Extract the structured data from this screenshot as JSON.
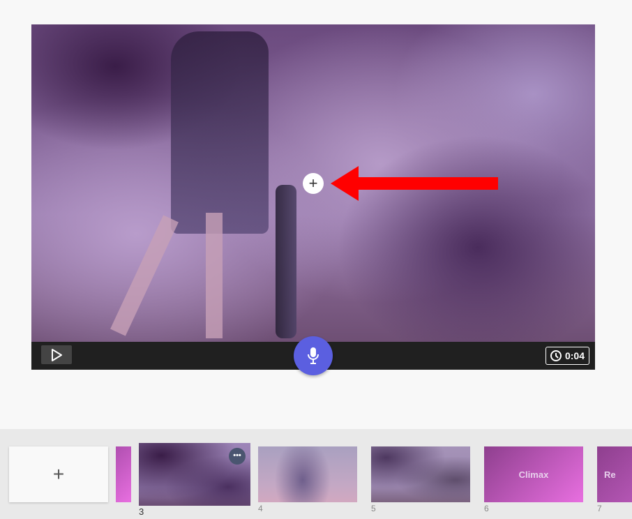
{
  "player": {
    "time": "0:04",
    "play_icon": "play-icon",
    "mic_icon": "microphone-icon",
    "clock_icon": "clock-icon",
    "add_icon": "plus-icon"
  },
  "annotation": {
    "arrow_color": "#ff0000"
  },
  "timeline": {
    "new_slide_label": "+",
    "slides": [
      {
        "number": "3",
        "title": "",
        "selected": true
      },
      {
        "number": "4",
        "title": ""
      },
      {
        "number": "5",
        "title": ""
      },
      {
        "number": "6",
        "title": "Climax"
      },
      {
        "number": "7",
        "title": "Re"
      }
    ],
    "more_label": "•••"
  },
  "colors": {
    "accent": "#5b5fe0",
    "slide_gradient": "#e86fe0"
  }
}
